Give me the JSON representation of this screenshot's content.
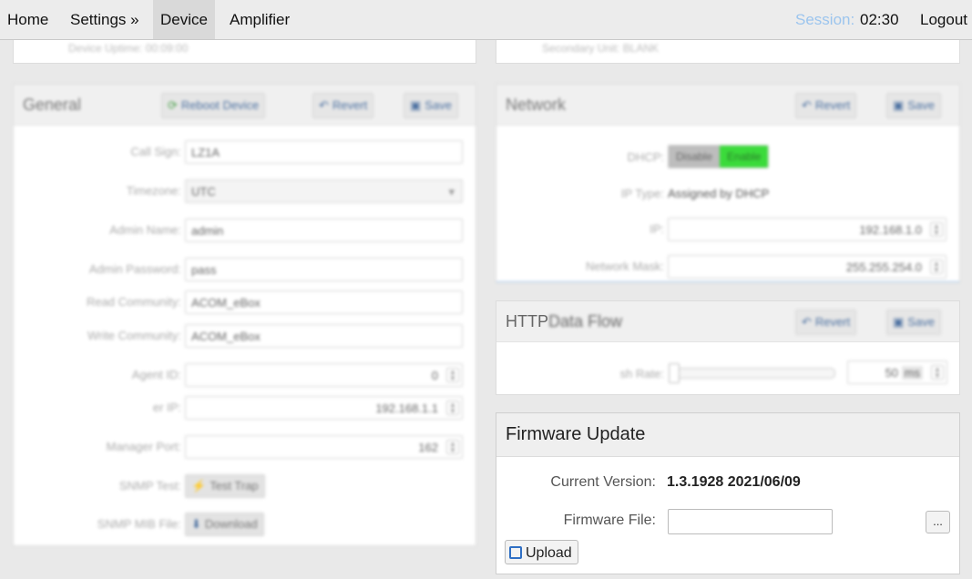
{
  "nav": {
    "home": "Home",
    "settings": "Settings »",
    "device": "Device",
    "amplifier": "Amplifier",
    "session_label": "Session:",
    "session_time": "02:30",
    "logout": "Logout"
  },
  "top_fragments": {
    "left": "Device Uptime: 00:09:00",
    "right": "Secondary Unit: BLANK"
  },
  "general": {
    "title": "General",
    "reboot": "Reboot Device",
    "revert": "Revert",
    "save": "Save",
    "call_sign_label": "Call Sign:",
    "call_sign": "LZ1A",
    "timezone_label": "Timezone:",
    "timezone": "UTC",
    "admin_name_label": "Admin Name:",
    "admin_name": "admin",
    "admin_password_label": "Admin Password:",
    "admin_password": "pass",
    "read_community_label": "Read Community:",
    "read_community": "ACOM_eBox",
    "write_community_label": "Write Community:",
    "write_community": "ACOM_eBox",
    "agent_id_label": "Agent ID:",
    "agent_id": "0",
    "manager_ip_label": "er IP:",
    "manager_ip": "192.168.1.1",
    "manager_port_label": "Manager Port:",
    "manager_port": "162",
    "snmp_test_label": "SNMP Test:",
    "test_trap": "Test Trap",
    "snmp_mib_label": "SNMP MIB File:",
    "download": "Download"
  },
  "network": {
    "title": "Network",
    "revert": "Revert",
    "save": "Save",
    "dhcp_label": "DHCP:",
    "disable": "Disable",
    "enable": "Enable",
    "ip_type_label": "IP Type:",
    "ip_type": "Assigned by DHCP",
    "ip_label": "IP:",
    "ip": "192.168.1.0",
    "mask_label": "Network Mask:",
    "mask": "255.255.254.0"
  },
  "http": {
    "title_prefix": "HTTP",
    "title_rest": "Data Flow",
    "revert": "Revert",
    "save": "Save",
    "rate_label": "sh Rate:",
    "rate_value": "50",
    "rate_unit": "ms"
  },
  "firmware": {
    "title": "Firmware Update",
    "current_version_label": "Current Version:",
    "current_version": "1.3.1928 2021/06/09",
    "file_label": "Firmware File:",
    "file_value": "",
    "browse": "...",
    "upload": "Upload"
  }
}
